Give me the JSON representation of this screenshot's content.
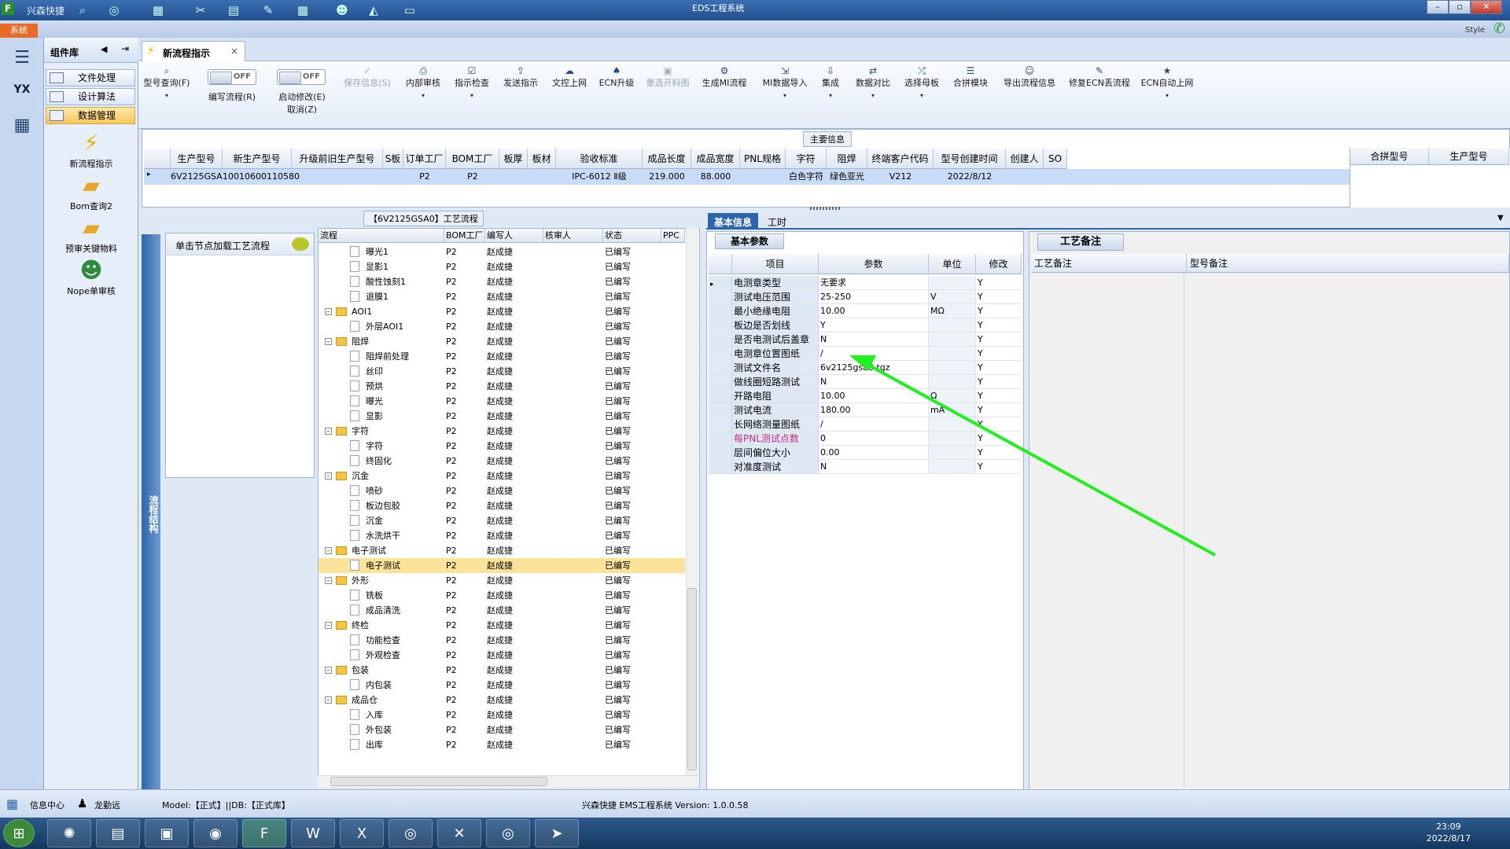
{
  "app": {
    "name": "兴森快捷",
    "window_title": "EDS工程系统",
    "style_label": "Style",
    "sys_tab": "系统"
  },
  "left_nav": {
    "title": "组件库",
    "buttons": [
      "文件处理",
      "设计算法",
      "数据管理"
    ],
    "selected": "数据管理",
    "items": [
      "新流程指示",
      "Bom查询2",
      "预审关键物料",
      "Nope单审核"
    ]
  },
  "doc_tab": {
    "label": "新流程指示"
  },
  "toolbar": {
    "items": [
      {
        "label": "型号查询(F)",
        "icon": "search-icon"
      },
      {
        "label": "编写流程(R)",
        "toggle": "OFF"
      },
      {
        "label": "启动修改(E)",
        "label2": "取消(Z)",
        "toggle": "OFF"
      },
      {
        "label": "保存信息(S)",
        "disabled": true,
        "icon": "check-icon"
      },
      {
        "label": "内部审核",
        "icon": "print-icon"
      },
      {
        "label": "指示检查",
        "icon": "checkbox-icon"
      },
      {
        "label": "发送指示",
        "icon": "upload-icon"
      },
      {
        "label": "文控上网",
        "icon": "cloud-icon"
      },
      {
        "label": "ECN升级",
        "icon": "ecn-icon"
      },
      {
        "label": "重选开料图",
        "disabled": true,
        "icon": "image-icon"
      },
      {
        "label": "生成MI流程",
        "icon": "gears-icon"
      },
      {
        "label": "MI数据导入",
        "icon": "import-icon"
      },
      {
        "label": "集成",
        "icon": "download-icon"
      },
      {
        "label": "数据对比",
        "icon": "compare-icon"
      },
      {
        "label": "选择母板",
        "icon": "shuffle-icon"
      },
      {
        "label": "合拼模块",
        "icon": "list-icon"
      },
      {
        "label": "导出流程信息",
        "icon": "smile-icon"
      },
      {
        "label": "修复ECN丢流程",
        "icon": "wrench-icon"
      },
      {
        "label": "ECN自动上网",
        "icon": "star-icon"
      }
    ]
  },
  "main_info": {
    "title": "主要信息",
    "columns": [
      "生产型号",
      "新生产型号",
      "升级前旧生产型号",
      "S板",
      "订单工厂",
      "BOM工厂",
      "板厚",
      "板材",
      "验收标准",
      "成品长度",
      "成品宽度",
      "PNL规格",
      "字符",
      "阻焊",
      "终端客户代码",
      "型号创建时间",
      "创建人",
      "SO"
    ],
    "row": [
      "6V2125GSA0",
      "10010600110580",
      "",
      "",
      "P2",
      "P2",
      "",
      "",
      "IPC-6012 Ⅱ级",
      "219.000",
      "88.000",
      "",
      "白色字符",
      "绿色亚光",
      "V212",
      "2022/8/12",
      "",
      ""
    ],
    "merge_columns": [
      "合拼型号",
      "生产型号"
    ]
  },
  "side_caption": "流程结构",
  "load_panel": {
    "text": "单击节点加载工艺流程"
  },
  "tree": {
    "title": "【6V2125GSA0】工艺流程",
    "columns": [
      "流程",
      "BOM工厂",
      "编写人",
      "核审人",
      "状态",
      "PPC"
    ],
    "rows": [
      {
        "t": "曝光1",
        "lvl": 2,
        "f": "P2",
        "w": "赵成捷",
        "s": "已编写"
      },
      {
        "t": "显影1",
        "lvl": 2,
        "f": "P2",
        "w": "赵成捷",
        "s": "已编写"
      },
      {
        "t": "酸性蚀刻1",
        "lvl": 2,
        "f": "P2",
        "w": "赵成捷",
        "s": "已编写"
      },
      {
        "t": "退膜1",
        "lvl": 2,
        "f": "P2",
        "w": "赵成捷",
        "s": "已编写"
      },
      {
        "t": "AOI1",
        "lvl": 1,
        "f": "P2",
        "w": "赵成捷",
        "s": "已编写"
      },
      {
        "t": "外层AOI1",
        "lvl": 2,
        "f": "P2",
        "w": "赵成捷",
        "s": "已编写"
      },
      {
        "t": "阻焊",
        "lvl": 1,
        "f": "P2",
        "w": "赵成捷",
        "s": "已编写"
      },
      {
        "t": "阻焊前处理",
        "lvl": 2,
        "f": "P2",
        "w": "赵成捷",
        "s": "已编写"
      },
      {
        "t": "丝印",
        "lvl": 2,
        "f": "P2",
        "w": "赵成捷",
        "s": "已编写"
      },
      {
        "t": "预烘",
        "lvl": 2,
        "f": "P2",
        "w": "赵成捷",
        "s": "已编写"
      },
      {
        "t": "曝光",
        "lvl": 2,
        "f": "P2",
        "w": "赵成捷",
        "s": "已编写"
      },
      {
        "t": "显影",
        "lvl": 2,
        "f": "P2",
        "w": "赵成捷",
        "s": "已编写"
      },
      {
        "t": "字符",
        "lvl": 1,
        "f": "P2",
        "w": "赵成捷",
        "s": "已编写"
      },
      {
        "t": "字符",
        "lvl": 2,
        "f": "P2",
        "w": "赵成捷",
        "s": "已编写"
      },
      {
        "t": "终固化",
        "lvl": 2,
        "f": "P2",
        "w": "赵成捷",
        "s": "已编写"
      },
      {
        "t": "沉金",
        "lvl": 1,
        "f": "P2",
        "w": "赵成捷",
        "s": "已编写"
      },
      {
        "t": "喷砂",
        "lvl": 2,
        "f": "P2",
        "w": "赵成捷",
        "s": "已编写"
      },
      {
        "t": "板边包胶",
        "lvl": 2,
        "f": "P2",
        "w": "赵成捷",
        "s": "已编写"
      },
      {
        "t": "沉金",
        "lvl": 2,
        "f": "P2",
        "w": "赵成捷",
        "s": "已编写"
      },
      {
        "t": "水洗烘干",
        "lvl": 2,
        "f": "P2",
        "w": "赵成捷",
        "s": "已编写"
      },
      {
        "t": "电子测试",
        "lvl": 1,
        "f": "P2",
        "w": "赵成捷",
        "s": "已编写"
      },
      {
        "t": "电子测试",
        "lvl": 2,
        "f": "P2",
        "w": "赵成捷",
        "s": "已编写",
        "hl": true
      },
      {
        "t": "外形",
        "lvl": 1,
        "f": "P2",
        "w": "赵成捷",
        "s": "已编写"
      },
      {
        "t": "铣板",
        "lvl": 2,
        "f": "P2",
        "w": "赵成捷",
        "s": "已编写"
      },
      {
        "t": "成品清洗",
        "lvl": 2,
        "f": "P2",
        "w": "赵成捷",
        "s": "已编写"
      },
      {
        "t": "终检",
        "lvl": 1,
        "f": "P2",
        "w": "赵成捷",
        "s": "已编写"
      },
      {
        "t": "功能检查",
        "lvl": 2,
        "f": "P2",
        "w": "赵成捷",
        "s": "已编写"
      },
      {
        "t": "外观检查",
        "lvl": 2,
        "f": "P2",
        "w": "赵成捷",
        "s": "已编写"
      },
      {
        "t": "包装",
        "lvl": 1,
        "f": "P2",
        "w": "赵成捷",
        "s": "已编写"
      },
      {
        "t": "内包装",
        "lvl": 2,
        "f": "P2",
        "w": "赵成捷",
        "s": "已编写"
      },
      {
        "t": "成品仓",
        "lvl": 1,
        "f": "P2",
        "w": "赵成捷",
        "s": "已编写"
      },
      {
        "t": "入库",
        "lvl": 2,
        "f": "P2",
        "w": "赵成捷",
        "s": "已编写"
      },
      {
        "t": "外包装",
        "lvl": 2,
        "f": "P2",
        "w": "赵成捷",
        "s": "已编写"
      },
      {
        "t": "出库",
        "lvl": 2,
        "f": "P2",
        "w": "赵成捷",
        "s": "已编写"
      }
    ]
  },
  "right_tabs": [
    "基本信息",
    "工时"
  ],
  "basic": {
    "subtitle": "基本参数",
    "columns": [
      "项目",
      "参数",
      "单位",
      "修改"
    ],
    "rows": [
      {
        "k": "电测章类型",
        "v": "无要求",
        "u": "",
        "m": "Y"
      },
      {
        "k": "测试电压范围",
        "v": "25-250",
        "u": "V",
        "m": "Y"
      },
      {
        "k": "最小绝缘电阻",
        "v": "10.00",
        "u": "MΩ",
        "m": "Y"
      },
      {
        "k": "板边是否划线",
        "v": "Y",
        "u": "",
        "m": "Y"
      },
      {
        "k": "是否电测试后盖章",
        "v": "N",
        "u": "",
        "m": "Y"
      },
      {
        "k": "电测章位置图纸",
        "v": "/",
        "u": "",
        "m": "Y"
      },
      {
        "k": "测试文件名",
        "v": "6v2125gsa0.tgz",
        "u": "",
        "m": "Y"
      },
      {
        "k": "做线圈短路测试",
        "v": "N",
        "u": "",
        "m": "Y"
      },
      {
        "k": "开路电阻",
        "v": "10.00",
        "u": "Ω",
        "m": "Y"
      },
      {
        "k": "测试电流",
        "v": "180.00",
        "u": "mA",
        "m": "Y"
      },
      {
        "k": "长网络测量图纸",
        "v": "/",
        "u": "",
        "m": "Y"
      },
      {
        "k": "每PNL测试点数",
        "v": "0",
        "u": "",
        "m": "Y",
        "pink": true
      },
      {
        "k": "层间偏位大小",
        "v": "0.00",
        "u": "",
        "m": "Y"
      },
      {
        "k": "对准度测试",
        "v": "N",
        "u": "",
        "m": "Y"
      }
    ]
  },
  "notes": {
    "subtitle": "工艺备注",
    "columns": [
      "工艺备注",
      "型号备注"
    ]
  },
  "status": {
    "info": "信息中心",
    "user": "龙勤远",
    "model": "Model:【正式】||DB:【正式库】",
    "version": "兴森快捷 EMS工程系统 Version: 1.0.0.58"
  },
  "clock": {
    "time": "23:09",
    "date": "2022/8/17"
  },
  "colors": {
    "accent": "#2d66a8",
    "highlight": "#fbe39a",
    "arrow": "#22ee22"
  }
}
